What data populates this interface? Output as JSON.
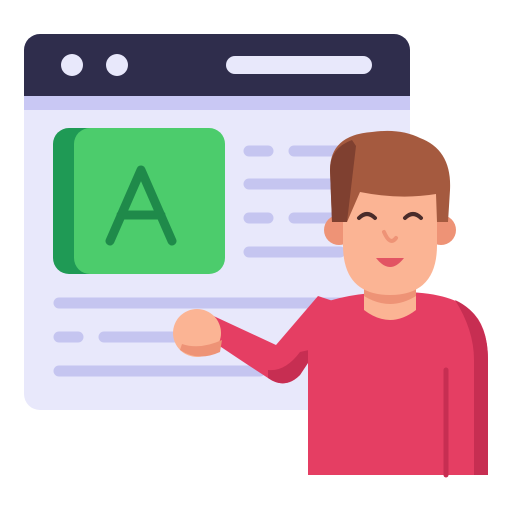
{
  "illustration": {
    "tile_letter": "A",
    "colors": {
      "window_header": "#2f2d4c",
      "window_subheader": "#c9c8f4",
      "window_body": "#e8e8fb",
      "text_line": "#c5c5f0",
      "url_bar": "#e8e8fb",
      "tile_face": "#4ccc6c",
      "tile_shadow": "#1f9a55",
      "letter": "#1f8a4a",
      "shirt": "#e53e63",
      "shirt_shadow": "#c72e52",
      "skin": "#fbb494",
      "skin_shadow": "#ee9376",
      "hair": "#a55a3f",
      "hair_shadow": "#7f4030",
      "eyes": "#4a2c2a",
      "mouth": "#e25463"
    },
    "icons": [
      "browser-window-icon",
      "presenter-icon"
    ]
  }
}
